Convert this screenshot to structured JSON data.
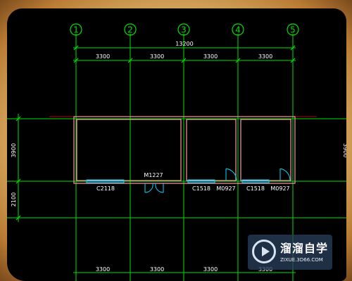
{
  "axes": [
    "1",
    "2",
    "3",
    "4",
    "5"
  ],
  "total_dimension": "13200",
  "top_spans": [
    "3300",
    "3300",
    "3300",
    "3300"
  ],
  "bottom_spans": [
    "3300",
    "3300",
    "3300",
    "3300"
  ],
  "left_dims": [
    "3900",
    "2100"
  ],
  "right_dim": "3900",
  "windows": [
    "C2118",
    "C1518",
    "C1518"
  ],
  "doors": [
    "M1227",
    "M0927",
    "M0927"
  ],
  "watermark": {
    "title": "溜溜自学",
    "url": "ZIXUE.3D66.COM"
  },
  "colors": {
    "wall": "#ff9a9a",
    "axis": "#00e000",
    "grid": "#c00000",
    "window": "#00d8ff",
    "door": "#00d8ff",
    "text": "#ffffff"
  }
}
